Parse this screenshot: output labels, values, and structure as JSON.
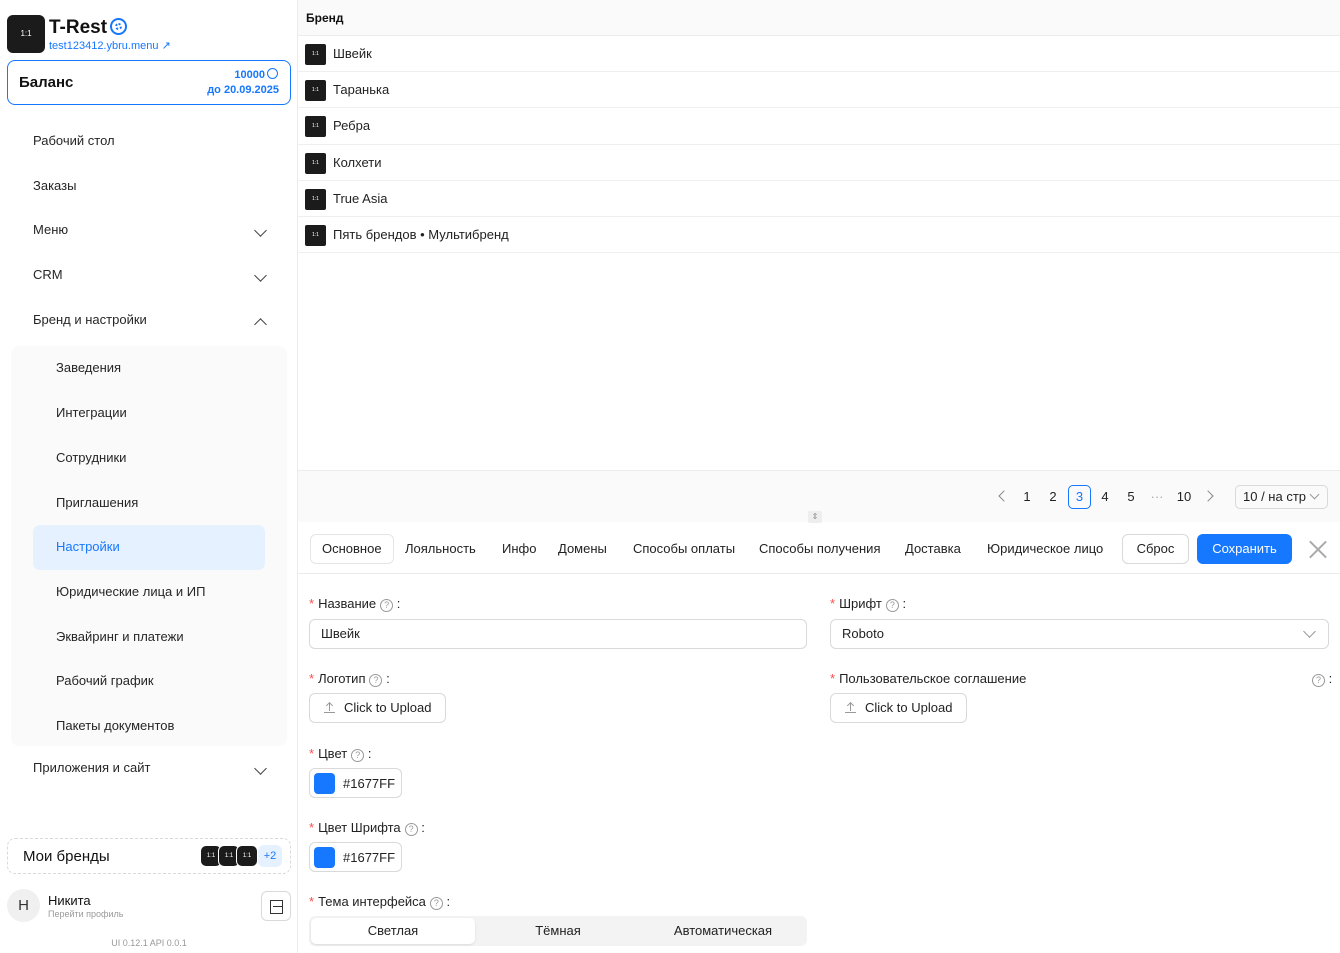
{
  "brand": {
    "title": "T-Rest",
    "domain": "test123412.ybru.menu ↗",
    "logo_text": "1:1"
  },
  "balance": {
    "label": "Баланс",
    "amount": "10000",
    "valid_until": "до 20.09.2025"
  },
  "nav": {
    "items": [
      {
        "label": "Рабочий стол"
      },
      {
        "label": "Заказы"
      },
      {
        "label": "Меню"
      },
      {
        "label": "CRM"
      },
      {
        "label": "Бренд и настройки"
      },
      {
        "label": "Приложения и сайт"
      }
    ],
    "sub": [
      {
        "label": "Заведения"
      },
      {
        "label": "Интеграции"
      },
      {
        "label": "Сотрудники"
      },
      {
        "label": "Приглашения"
      },
      {
        "label": "Настройки"
      },
      {
        "label": "Юридические лица и ИП"
      },
      {
        "label": "Эквайринг и платежи"
      },
      {
        "label": "Рабочий график"
      },
      {
        "label": "Пакеты документов"
      }
    ]
  },
  "my_brands": {
    "label": "Мои бренды",
    "more": "+2"
  },
  "user": {
    "initial": "Н",
    "name": "Никита",
    "sub": "Перейти профиль"
  },
  "version": "UI 0.12.1 API 0.0.1",
  "table": {
    "header": "Бренд",
    "rows": [
      "Швейк",
      "Таранька",
      "Ребра",
      "Колхети",
      "True Asia",
      "Пять брендов • Мультибренд"
    ]
  },
  "pagination": {
    "pages": [
      "1",
      "2",
      "3",
      "4",
      "5",
      "···",
      "10"
    ],
    "current": "3",
    "page_size": "10 / на стр"
  },
  "tabs": [
    "Основное",
    "Лояльность",
    "Инфо",
    "Домены",
    "Способы оплаты",
    "Способы получения",
    "Доставка",
    "Юридическое лицо"
  ],
  "actions": {
    "reset": "Сброс",
    "save": "Сохранить"
  },
  "form": {
    "name_label": "Название",
    "name_value": "Швейк",
    "font_label": "Шрифт",
    "font_value": "Roboto",
    "logo_label": "Логотип",
    "upload_label": "Click to Upload",
    "agreement_label": "Пользовательское соглашение",
    "color_label": "Цвет",
    "color_value": "#1677FF",
    "font_color_label": "Цвет Шрифта",
    "font_color_value": "#1677FF",
    "theme_label": "Тема интерфейса",
    "theme_options": [
      "Светлая",
      "Тёмная",
      "Автоматическая"
    ]
  },
  "colors": {
    "accent": "#1677ff",
    "danger": "#ff4d4f"
  }
}
